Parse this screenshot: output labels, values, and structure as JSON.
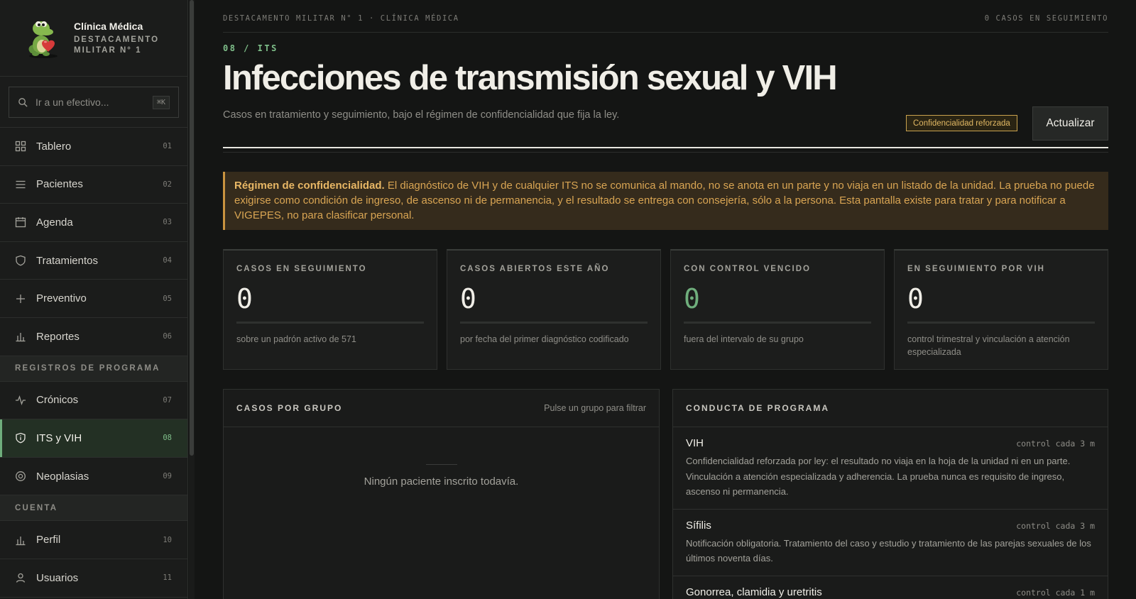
{
  "brand": {
    "name": "Clínica Médica",
    "sub1": "DESTACAMENTO",
    "sub2": "MILITAR N° 1"
  },
  "search": {
    "placeholder": "Ir a un efectivo...",
    "shortcut": "⌘K"
  },
  "nav": {
    "items": [
      {
        "label": "Tablero",
        "num": "01",
        "icon": "dashboard-grid-icon"
      },
      {
        "label": "Pacientes",
        "num": "02",
        "icon": "list-icon"
      },
      {
        "label": "Agenda",
        "num": "03",
        "icon": "calendar-icon"
      },
      {
        "label": "Tratamientos",
        "num": "04",
        "icon": "shield-icon"
      },
      {
        "label": "Preventivo",
        "num": "05",
        "icon": "plus-icon"
      },
      {
        "label": "Reportes",
        "num": "06",
        "icon": "bar-chart-icon"
      }
    ],
    "section_programs": "REGISTROS DE PROGRAMA",
    "program_items": [
      {
        "label": "Crónicos",
        "num": "07",
        "icon": "pulse-icon"
      },
      {
        "label": "ITS y VIH",
        "num": "08",
        "icon": "shield-info-icon"
      },
      {
        "label": "Neoplasias",
        "num": "09",
        "icon": "target-icon"
      }
    ],
    "section_account": "CUENTA",
    "account_items": [
      {
        "label": "Perfil",
        "num": "10",
        "icon": "bar-chart-icon"
      },
      {
        "label": "Usuarios",
        "num": "11",
        "icon": "user-icon"
      }
    ]
  },
  "topbar": {
    "left": "DESTACAMENTO MILITAR N° 1 · CLÍNICA MÉDICA",
    "right": "0 CASOS EN SEGUIMIENTO"
  },
  "header": {
    "kicker": "08 / ITS",
    "title": "Infecciones de transmisión sexual y VIH",
    "subtitle": "Casos en tratamiento y seguimiento, bajo el régimen de confidencialidad que fija la ley.",
    "badge": "Confidencialidad reforzada",
    "refresh_label": "Actualizar"
  },
  "alert": {
    "lead": "Régimen de confidencialidad.",
    "text": " El diagnóstico de VIH y de cualquier ITS no se comunica al mando, no se anota en un parte y no viaja en un listado de la unidad. La prueba no puede exigirse como condición de ingreso, de ascenso ni de permanencia, y el resultado se entrega con consejería, sólo a la persona. Esta pantalla existe para tratar y para notificar a VIGEPES, no para clasificar personal."
  },
  "kpis": [
    {
      "label": "CASOS EN SEGUIMIENTO",
      "value": "0",
      "note": "sobre un padrón activo de 571"
    },
    {
      "label": "CASOS ABIERTOS ESTE AÑO",
      "value": "0",
      "note": "por fecha del primer diagnóstico codificado"
    },
    {
      "label": "CON CONTROL VENCIDO",
      "value": "0",
      "note": "fuera del intervalo de su grupo"
    },
    {
      "label": "EN SEGUIMIENTO POR VIH",
      "value": "0",
      "note": "control trimestral y vinculación a atención especializada"
    }
  ],
  "groups_panel": {
    "title": "CASOS POR GRUPO",
    "hint": "Pulse un grupo para filtrar",
    "empty": "Ningún paciente inscrito todavía."
  },
  "conduct_panel": {
    "title": "CONDUCTA DE PROGRAMA",
    "items": [
      {
        "name": "VIH",
        "freq": "control cada 3 m",
        "desc": "Confidencialidad reforzada por ley: el resultado no viaja en la hoja de la unidad ni en un parte. Vinculación a atención especializada y adherencia. La prueba nunca es requisito de ingreso, ascenso ni permanencia."
      },
      {
        "name": "Sífilis",
        "freq": "control cada 3 m",
        "desc": "Notificación obligatoria. Tratamiento del caso y estudio y tratamiento de las parejas sexuales de los últimos noventa días."
      },
      {
        "name": "Gonorrea, clamidia y uretritis",
        "freq": "control cada 1 m",
        "desc": ""
      }
    ]
  },
  "colors": {
    "accent_green": "#6fae7c",
    "warning_amber": "#d9a553",
    "background": "#141514"
  }
}
